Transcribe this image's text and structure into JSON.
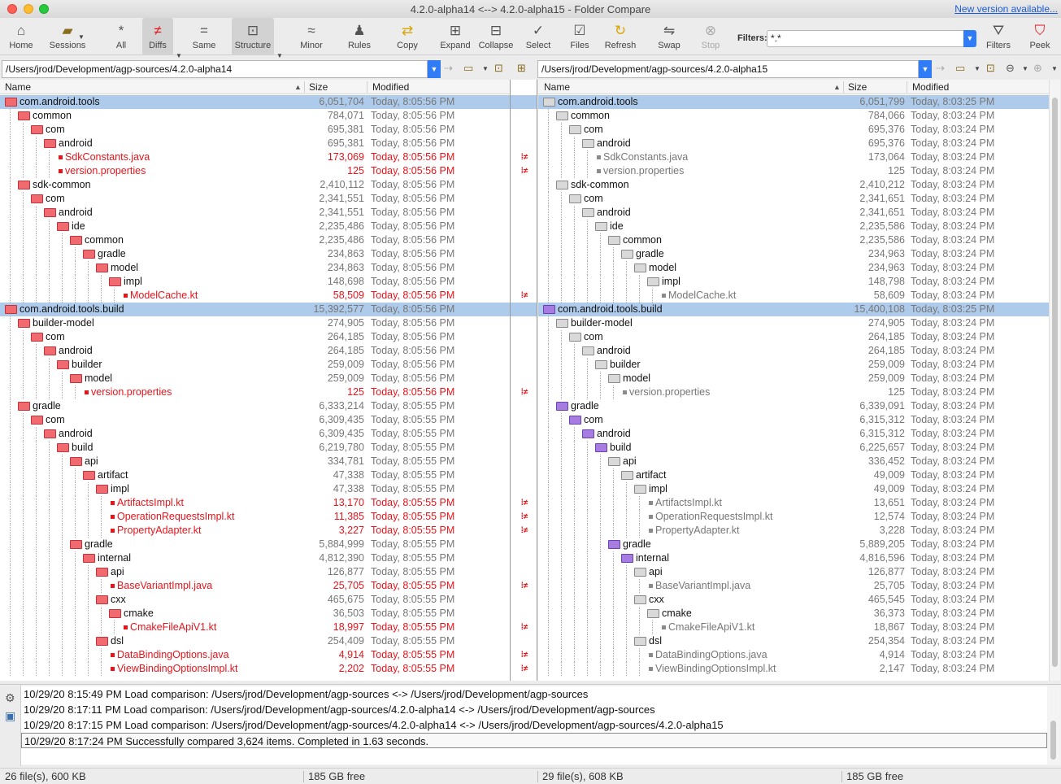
{
  "window": {
    "title": "4.2.0-alpha14 <--> 4.2.0-alpha15 - Folder Compare",
    "new_version_link": "New version available..."
  },
  "toolbar": {
    "home": "Home",
    "sessions": "Sessions",
    "all": "All",
    "diffs": "Diffs",
    "same": "Same",
    "structure": "Structure",
    "minor": "Minor",
    "rules": "Rules",
    "copy": "Copy",
    "expand": "Expand",
    "collapse": "Collapse",
    "select": "Select",
    "files": "Files",
    "refresh": "Refresh",
    "swap": "Swap",
    "stop": "Stop",
    "filters_label": "Filters:",
    "filters_value": "*.*",
    "filters": "Filters",
    "peek": "Peek"
  },
  "left_path": "/Users/jrod/Development/agp-sources/4.2.0-alpha14",
  "right_path": "/Users/jrod/Development/agp-sources/4.2.0-alpha15",
  "columns": {
    "name": "Name",
    "size": "Size",
    "modified": "Modified"
  },
  "left_rows": [
    {
      "depth": 0,
      "type": "folder",
      "name": "com.android.tools",
      "size": "6,051,704",
      "modified": "Today, 8:05:56 PM",
      "sel": true,
      "color": "red"
    },
    {
      "depth": 1,
      "type": "folder",
      "name": "common",
      "size": "784,071",
      "modified": "Today, 8:05:56 PM",
      "color": "red"
    },
    {
      "depth": 2,
      "type": "folder",
      "name": "com",
      "size": "695,381",
      "modified": "Today, 8:05:56 PM",
      "color": "red"
    },
    {
      "depth": 3,
      "type": "folder",
      "name": "android",
      "size": "695,381",
      "modified": "Today, 8:05:56 PM",
      "color": "red"
    },
    {
      "depth": 4,
      "type": "file",
      "name": "SdkConstants.java",
      "size": "173,069",
      "modified": "Today, 8:05:56 PM",
      "diff": true
    },
    {
      "depth": 4,
      "type": "file",
      "name": "version.properties",
      "size": "125",
      "modified": "Today, 8:05:56 PM",
      "diff": true
    },
    {
      "depth": 1,
      "type": "folder",
      "name": "sdk-common",
      "size": "2,410,112",
      "modified": "Today, 8:05:56 PM",
      "color": "red"
    },
    {
      "depth": 2,
      "type": "folder",
      "name": "com",
      "size": "2,341,551",
      "modified": "Today, 8:05:56 PM",
      "color": "red"
    },
    {
      "depth": 3,
      "type": "folder",
      "name": "android",
      "size": "2,341,551",
      "modified": "Today, 8:05:56 PM",
      "color": "red"
    },
    {
      "depth": 4,
      "type": "folder",
      "name": "ide",
      "size": "2,235,486",
      "modified": "Today, 8:05:56 PM",
      "color": "red"
    },
    {
      "depth": 5,
      "type": "folder",
      "name": "common",
      "size": "2,235,486",
      "modified": "Today, 8:05:56 PM",
      "color": "red"
    },
    {
      "depth": 6,
      "type": "folder",
      "name": "gradle",
      "size": "234,863",
      "modified": "Today, 8:05:56 PM",
      "color": "red"
    },
    {
      "depth": 7,
      "type": "folder",
      "name": "model",
      "size": "234,863",
      "modified": "Today, 8:05:56 PM",
      "color": "red"
    },
    {
      "depth": 8,
      "type": "folder",
      "name": "impl",
      "size": "148,698",
      "modified": "Today, 8:05:56 PM",
      "color": "red"
    },
    {
      "depth": 9,
      "type": "file",
      "name": "ModelCache.kt",
      "size": "58,509",
      "modified": "Today, 8:05:56 PM",
      "diff": true
    },
    {
      "depth": 0,
      "type": "folder",
      "name": "com.android.tools.build",
      "size": "15,392,577",
      "modified": "Today, 8:05:56 PM",
      "sel": true,
      "color": "red"
    },
    {
      "depth": 1,
      "type": "folder",
      "name": "builder-model",
      "size": "274,905",
      "modified": "Today, 8:05:56 PM",
      "color": "red"
    },
    {
      "depth": 2,
      "type": "folder",
      "name": "com",
      "size": "264,185",
      "modified": "Today, 8:05:56 PM",
      "color": "red"
    },
    {
      "depth": 3,
      "type": "folder",
      "name": "android",
      "size": "264,185",
      "modified": "Today, 8:05:56 PM",
      "color": "red"
    },
    {
      "depth": 4,
      "type": "folder",
      "name": "builder",
      "size": "259,009",
      "modified": "Today, 8:05:56 PM",
      "color": "red"
    },
    {
      "depth": 5,
      "type": "folder",
      "name": "model",
      "size": "259,009",
      "modified": "Today, 8:05:56 PM",
      "color": "red"
    },
    {
      "depth": 6,
      "type": "file",
      "name": "version.properties",
      "size": "125",
      "modified": "Today, 8:05:56 PM",
      "diff": true
    },
    {
      "depth": 1,
      "type": "folder",
      "name": "gradle",
      "size": "6,333,214",
      "modified": "Today, 8:05:55 PM",
      "color": "red"
    },
    {
      "depth": 2,
      "type": "folder",
      "name": "com",
      "size": "6,309,435",
      "modified": "Today, 8:05:55 PM",
      "color": "red"
    },
    {
      "depth": 3,
      "type": "folder",
      "name": "android",
      "size": "6,309,435",
      "modified": "Today, 8:05:55 PM",
      "color": "red"
    },
    {
      "depth": 4,
      "type": "folder",
      "name": "build",
      "size": "6,219,780",
      "modified": "Today, 8:05:55 PM",
      "color": "red"
    },
    {
      "depth": 5,
      "type": "folder",
      "name": "api",
      "size": "334,781",
      "modified": "Today, 8:05:55 PM",
      "color": "red"
    },
    {
      "depth": 6,
      "type": "folder",
      "name": "artifact",
      "size": "47,338",
      "modified": "Today, 8:05:55 PM",
      "color": "red"
    },
    {
      "depth": 7,
      "type": "folder",
      "name": "impl",
      "size": "47,338",
      "modified": "Today, 8:05:55 PM",
      "color": "red"
    },
    {
      "depth": 8,
      "type": "file",
      "name": "ArtifactsImpl.kt",
      "size": "13,170",
      "modified": "Today, 8:05:55 PM",
      "diff": true
    },
    {
      "depth": 8,
      "type": "file",
      "name": "OperationRequestsImpl.kt",
      "size": "11,385",
      "modified": "Today, 8:05:55 PM",
      "diff": true
    },
    {
      "depth": 8,
      "type": "file",
      "name": "PropertyAdapter.kt",
      "size": "3,227",
      "modified": "Today, 8:05:55 PM",
      "diff": true
    },
    {
      "depth": 5,
      "type": "folder",
      "name": "gradle",
      "size": "5,884,999",
      "modified": "Today, 8:05:55 PM",
      "color": "red"
    },
    {
      "depth": 6,
      "type": "folder",
      "name": "internal",
      "size": "4,812,390",
      "modified": "Today, 8:05:55 PM",
      "color": "red"
    },
    {
      "depth": 7,
      "type": "folder",
      "name": "api",
      "size": "126,877",
      "modified": "Today, 8:05:55 PM",
      "color": "red"
    },
    {
      "depth": 8,
      "type": "file",
      "name": "BaseVariantImpl.java",
      "size": "25,705",
      "modified": "Today, 8:05:55 PM",
      "diff": true
    },
    {
      "depth": 7,
      "type": "folder",
      "name": "cxx",
      "size": "465,675",
      "modified": "Today, 8:05:55 PM",
      "color": "red"
    },
    {
      "depth": 8,
      "type": "folder",
      "name": "cmake",
      "size": "36,503",
      "modified": "Today, 8:05:55 PM",
      "color": "red"
    },
    {
      "depth": 9,
      "type": "file",
      "name": "CmakeFileApiV1.kt",
      "size": "18,997",
      "modified": "Today, 8:05:55 PM",
      "diff": true
    },
    {
      "depth": 7,
      "type": "folder",
      "name": "dsl",
      "size": "254,409",
      "modified": "Today, 8:05:55 PM",
      "color": "red"
    },
    {
      "depth": 8,
      "type": "file",
      "name": "DataBindingOptions.java",
      "size": "4,914",
      "modified": "Today, 8:05:55 PM",
      "diff": true
    },
    {
      "depth": 8,
      "type": "file",
      "name": "ViewBindingOptionsImpl.kt",
      "size": "2,202",
      "modified": "Today, 8:05:55 PM",
      "diff": true
    }
  ],
  "right_rows": [
    {
      "depth": 0,
      "type": "folder",
      "name": "com.android.tools",
      "size": "6,051,799",
      "modified": "Today, 8:03:25 PM",
      "sel": true,
      "color": "gray"
    },
    {
      "depth": 1,
      "type": "folder",
      "name": "common",
      "size": "784,066",
      "modified": "Today, 8:03:24 PM",
      "color": "gray"
    },
    {
      "depth": 2,
      "type": "folder",
      "name": "com",
      "size": "695,376",
      "modified": "Today, 8:03:24 PM",
      "color": "gray"
    },
    {
      "depth": 3,
      "type": "folder",
      "name": "android",
      "size": "695,376",
      "modified": "Today, 8:03:24 PM",
      "color": "gray"
    },
    {
      "depth": 4,
      "type": "file",
      "name": "SdkConstants.java",
      "size": "173,064",
      "modified": "Today, 8:03:24 PM",
      "ghost": true
    },
    {
      "depth": 4,
      "type": "file",
      "name": "version.properties",
      "size": "125",
      "modified": "Today, 8:03:24 PM",
      "ghost": true
    },
    {
      "depth": 1,
      "type": "folder",
      "name": "sdk-common",
      "size": "2,410,212",
      "modified": "Today, 8:03:24 PM",
      "color": "gray"
    },
    {
      "depth": 2,
      "type": "folder",
      "name": "com",
      "size": "2,341,651",
      "modified": "Today, 8:03:24 PM",
      "color": "gray"
    },
    {
      "depth": 3,
      "type": "folder",
      "name": "android",
      "size": "2,341,651",
      "modified": "Today, 8:03:24 PM",
      "color": "gray"
    },
    {
      "depth": 4,
      "type": "folder",
      "name": "ide",
      "size": "2,235,586",
      "modified": "Today, 8:03:24 PM",
      "color": "gray"
    },
    {
      "depth": 5,
      "type": "folder",
      "name": "common",
      "size": "2,235,586",
      "modified": "Today, 8:03:24 PM",
      "color": "gray"
    },
    {
      "depth": 6,
      "type": "folder",
      "name": "gradle",
      "size": "234,963",
      "modified": "Today, 8:03:24 PM",
      "color": "gray"
    },
    {
      "depth": 7,
      "type": "folder",
      "name": "model",
      "size": "234,963",
      "modified": "Today, 8:03:24 PM",
      "color": "gray"
    },
    {
      "depth": 8,
      "type": "folder",
      "name": "impl",
      "size": "148,798",
      "modified": "Today, 8:03:24 PM",
      "color": "gray"
    },
    {
      "depth": 9,
      "type": "file",
      "name": "ModelCache.kt",
      "size": "58,609",
      "modified": "Today, 8:03:24 PM",
      "ghost": true
    },
    {
      "depth": 0,
      "type": "folder",
      "name": "com.android.tools.build",
      "size": "15,400,108",
      "modified": "Today, 8:03:25 PM",
      "sel": true,
      "color": "purple"
    },
    {
      "depth": 1,
      "type": "folder",
      "name": "builder-model",
      "size": "274,905",
      "modified": "Today, 8:03:24 PM",
      "color": "gray"
    },
    {
      "depth": 2,
      "type": "folder",
      "name": "com",
      "size": "264,185",
      "modified": "Today, 8:03:24 PM",
      "color": "gray"
    },
    {
      "depth": 3,
      "type": "folder",
      "name": "android",
      "size": "264,185",
      "modified": "Today, 8:03:24 PM",
      "color": "gray"
    },
    {
      "depth": 4,
      "type": "folder",
      "name": "builder",
      "size": "259,009",
      "modified": "Today, 8:03:24 PM",
      "color": "gray"
    },
    {
      "depth": 5,
      "type": "folder",
      "name": "model",
      "size": "259,009",
      "modified": "Today, 8:03:24 PM",
      "color": "gray"
    },
    {
      "depth": 6,
      "type": "file",
      "name": "version.properties",
      "size": "125",
      "modified": "Today, 8:03:24 PM",
      "ghost": true
    },
    {
      "depth": 1,
      "type": "folder",
      "name": "gradle",
      "size": "6,339,091",
      "modified": "Today, 8:03:24 PM",
      "color": "purple"
    },
    {
      "depth": 2,
      "type": "folder",
      "name": "com",
      "size": "6,315,312",
      "modified": "Today, 8:03:24 PM",
      "color": "purple"
    },
    {
      "depth": 3,
      "type": "folder",
      "name": "android",
      "size": "6,315,312",
      "modified": "Today, 8:03:24 PM",
      "color": "purple"
    },
    {
      "depth": 4,
      "type": "folder",
      "name": "build",
      "size": "6,225,657",
      "modified": "Today, 8:03:24 PM",
      "color": "purple"
    },
    {
      "depth": 5,
      "type": "folder",
      "name": "api",
      "size": "336,452",
      "modified": "Today, 8:03:24 PM",
      "color": "gray"
    },
    {
      "depth": 6,
      "type": "folder",
      "name": "artifact",
      "size": "49,009",
      "modified": "Today, 8:03:24 PM",
      "color": "gray"
    },
    {
      "depth": 7,
      "type": "folder",
      "name": "impl",
      "size": "49,009",
      "modified": "Today, 8:03:24 PM",
      "color": "gray"
    },
    {
      "depth": 8,
      "type": "file",
      "name": "ArtifactsImpl.kt",
      "size": "13,651",
      "modified": "Today, 8:03:24 PM",
      "ghost": true
    },
    {
      "depth": 8,
      "type": "file",
      "name": "OperationRequestsImpl.kt",
      "size": "12,574",
      "modified": "Today, 8:03:24 PM",
      "ghost": true
    },
    {
      "depth": 8,
      "type": "file",
      "name": "PropertyAdapter.kt",
      "size": "3,228",
      "modified": "Today, 8:03:24 PM",
      "ghost": true
    },
    {
      "depth": 5,
      "type": "folder",
      "name": "gradle",
      "size": "5,889,205",
      "modified": "Today, 8:03:24 PM",
      "color": "purple"
    },
    {
      "depth": 6,
      "type": "folder",
      "name": "internal",
      "size": "4,816,596",
      "modified": "Today, 8:03:24 PM",
      "color": "purple"
    },
    {
      "depth": 7,
      "type": "folder",
      "name": "api",
      "size": "126,877",
      "modified": "Today, 8:03:24 PM",
      "color": "gray"
    },
    {
      "depth": 8,
      "type": "file",
      "name": "BaseVariantImpl.java",
      "size": "25,705",
      "modified": "Today, 8:03:24 PM",
      "ghost": true
    },
    {
      "depth": 7,
      "type": "folder",
      "name": "cxx",
      "size": "465,545",
      "modified": "Today, 8:03:24 PM",
      "color": "gray"
    },
    {
      "depth": 8,
      "type": "folder",
      "name": "cmake",
      "size": "36,373",
      "modified": "Today, 8:03:24 PM",
      "color": "gray"
    },
    {
      "depth": 9,
      "type": "file",
      "name": "CmakeFileApiV1.kt",
      "size": "18,867",
      "modified": "Today, 8:03:24 PM",
      "ghost": true
    },
    {
      "depth": 7,
      "type": "folder",
      "name": "dsl",
      "size": "254,354",
      "modified": "Today, 8:03:24 PM",
      "color": "gray"
    },
    {
      "depth": 8,
      "type": "file",
      "name": "DataBindingOptions.java",
      "size": "4,914",
      "modified": "Today, 8:03:24 PM",
      "ghost": true
    },
    {
      "depth": 8,
      "type": "file",
      "name": "ViewBindingOptionsImpl.kt",
      "size": "2,147",
      "modified": "Today, 8:03:24 PM",
      "ghost": true
    }
  ],
  "log": [
    "10/29/20 8:15:49 PM  Load comparison: /Users/jrod/Development/agp-sources <-> /Users/jrod/Development/agp-sources",
    "10/29/20 8:17:11 PM  Load comparison: /Users/jrod/Development/agp-sources/4.2.0-alpha14 <-> /Users/jrod/Development/agp-sources",
    "10/29/20 8:17:15 PM  Load comparison: /Users/jrod/Development/agp-sources/4.2.0-alpha14 <-> /Users/jrod/Development/agp-sources/4.2.0-alpha15",
    "10/29/20 8:17:24 PM  Successfully compared 3,624 items.  Completed in 1.63 seconds."
  ],
  "status": {
    "left_files": "26 file(s), 600 KB",
    "left_free": "185 GB free",
    "right_files": "29 file(s), 608 KB",
    "right_free": "185 GB free"
  },
  "colors": {
    "diff": "#e8141b",
    "selection": "#aecbeb",
    "accent": "#2f7cf6"
  }
}
